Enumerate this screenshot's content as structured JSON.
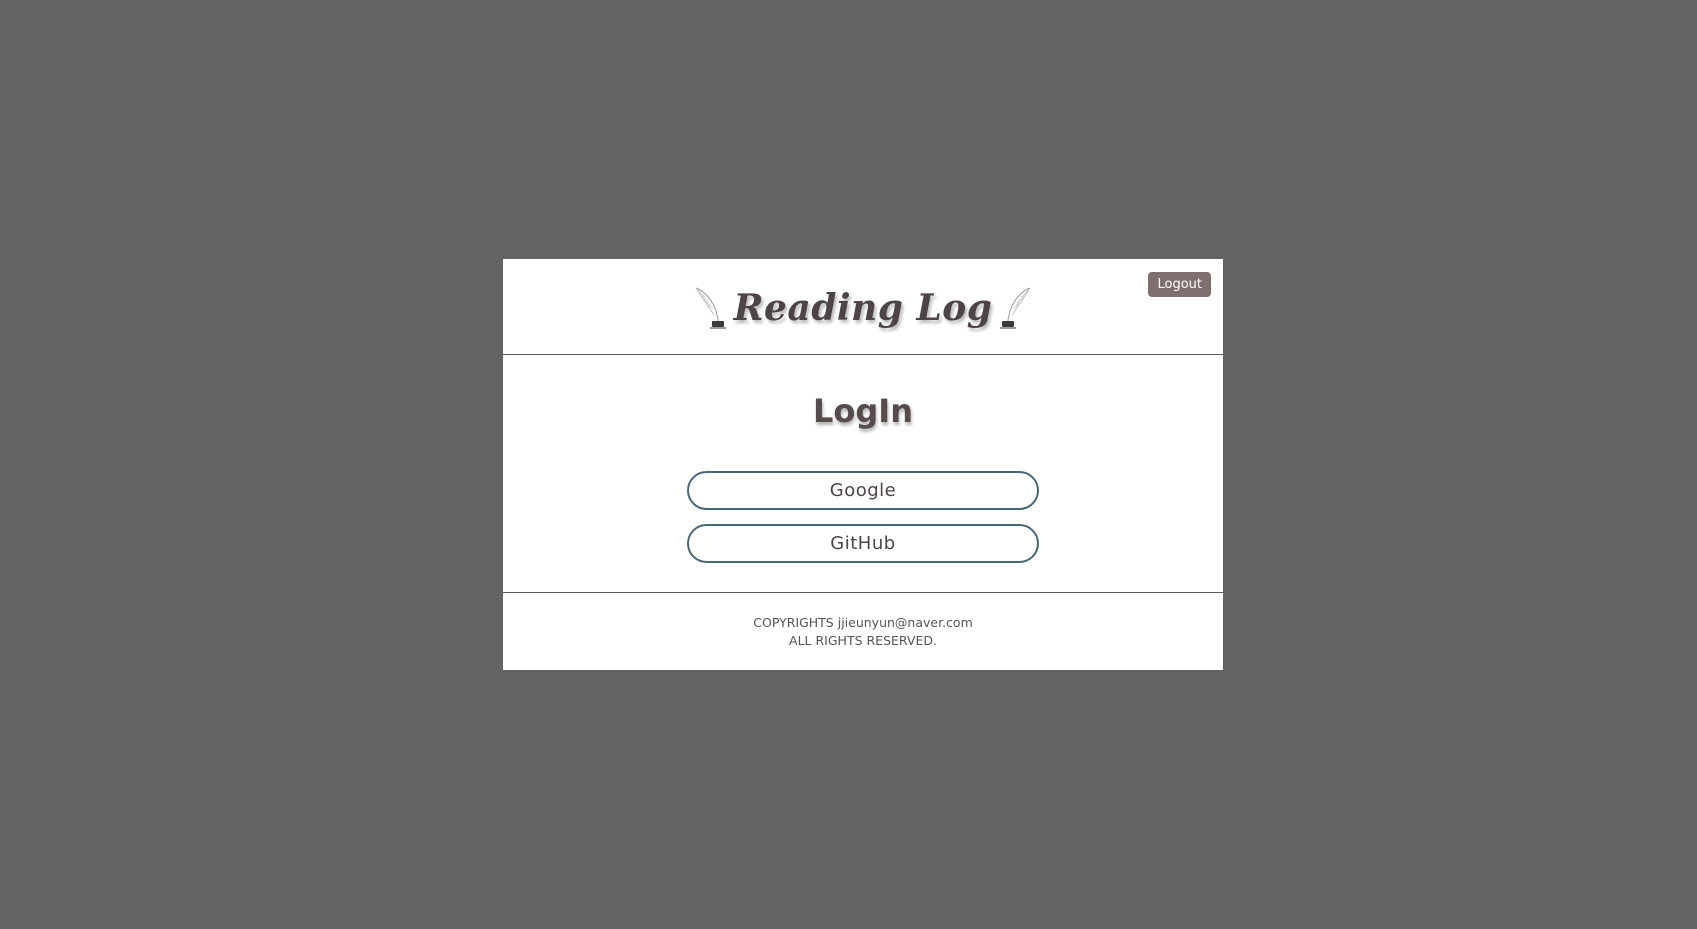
{
  "header": {
    "logo_text": "Reading Log",
    "logout_label": "Logout"
  },
  "main": {
    "title": "LogIn",
    "buttons": [
      {
        "label": "Google"
      },
      {
        "label": "GitHub"
      }
    ]
  },
  "footer": {
    "line1": "COPYRIGHTS jjieunyun@naver.com",
    "line2": "ALL RIGHTS RESERVED."
  },
  "colors": {
    "page_background": "#636363",
    "card_background": "#ffffff",
    "logout_button": "#7f6f6f",
    "login_button_border": "#4b6673",
    "text": "#4d4545"
  },
  "icons": [
    "quill-icon-left",
    "quill-icon-right"
  ]
}
